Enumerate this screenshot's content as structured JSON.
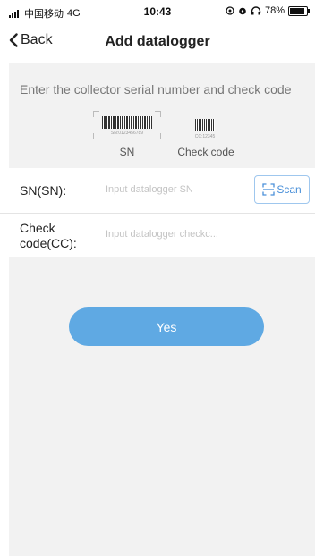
{
  "status_bar": {
    "carrier": "中国移动",
    "network": "4G",
    "time": "10:43",
    "battery_percent": "78%",
    "battery_level": 0.78,
    "icons": [
      "signal-icon",
      "location-icon",
      "alarm-icon",
      "headphones-icon",
      "battery-icon"
    ]
  },
  "nav": {
    "back_label": "Back",
    "title": "Add datalogger"
  },
  "instruction": "Enter the collector serial number and check code",
  "illustration": {
    "sn_barcode_text": "SN:0123456789",
    "cc_barcode_text": "CC:12345",
    "sn_label": "SN",
    "cc_label": "Check code"
  },
  "form": {
    "sn_label": "SN(SN):",
    "sn_placeholder": "Input datalogger SN",
    "sn_value": "",
    "scan_label": "Scan",
    "cc_label": "Check code(CC):",
    "cc_placeholder": "Input datalogger checkc...",
    "cc_value": ""
  },
  "submit_label": "Yes",
  "colors": {
    "accent": "#5fa9e3",
    "scan_border": "#9fc7ee",
    "gray_bg": "#f2f2f2"
  }
}
